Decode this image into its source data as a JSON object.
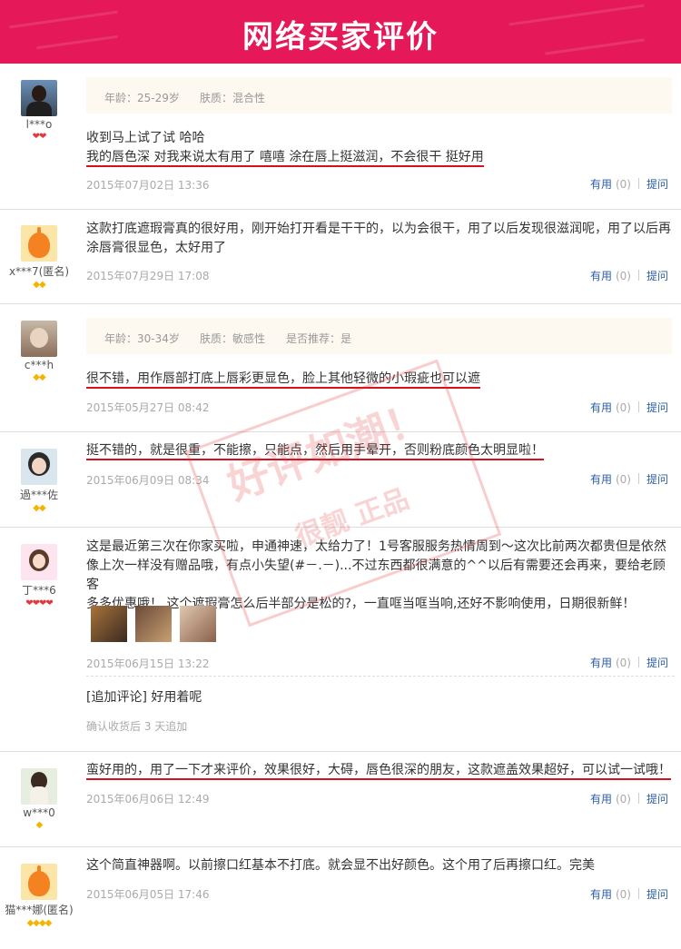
{
  "page": {
    "title": "网络买家评价"
  },
  "watermark": {
    "line1": "好评如潮！",
    "line2": "很靓 正品"
  },
  "labels": {
    "useful": "有用",
    "ask": "提问"
  },
  "reviews": [
    {
      "user": "l***o",
      "rank": "❤❤",
      "rank_color": "red",
      "info": [
        "年龄：25-29岁",
        "肤质：混合性"
      ],
      "lines": [
        "收到马上试了试 哈哈",
        "我的唇色深 对我来说太有用了 嘻嘻 涂在唇上挺滋润，不会很干 挺好用"
      ],
      "date": "2015年07月02日 13:36",
      "useful_count": "(0)"
    },
    {
      "user": "x***7(匿名)",
      "rank": "◆◆",
      "rank_color": "gold",
      "lines": [
        "这款打底遮瑕膏真的很好用，刚开始打开看是干干的，以为会很干，用了以后发现很滋润呢，用了以后再",
        "涂唇膏很显色，太好用了"
      ],
      "date": "2015年07月29日 17:08",
      "useful_count": "(0)"
    },
    {
      "user": "c***h",
      "rank": "◆◆",
      "rank_color": "gold",
      "info": [
        "年龄：30-34岁",
        "肤质：敏感性",
        "是否推荐：是"
      ],
      "lines": [
        "很不错，用作唇部打底上唇彩更显色，脸上其他轻微的小瑕疵也可以遮"
      ],
      "date": "2015年05月27日 08:42",
      "useful_count": "(0)"
    },
    {
      "user": "過***佐",
      "rank": "◆◆",
      "rank_color": "gold",
      "lines": [
        "挺不错的，就是很重，不能擦，只能点，然后用手晕开，否则粉底颜色太明显啦！"
      ],
      "date": "2015年06月09日 08:34",
      "useful_count": "(0)"
    },
    {
      "user": "丁***6",
      "rank": "❤❤❤❤",
      "rank_color": "red",
      "lines": [
        "这是最近第三次在你家买啦，申通神速，太给力了！1号客服服务热情周到～这次比前两次都贵但是依然",
        "像上次一样没有赠品哦，有点小失望(#－.－)...不过东西都很满意的^^以后有需要还会再来，要给老顾客",
        "多多优惠哦！ 这个遮瑕膏怎么后半部分是松的?，一直哐当哐当响,还好不影响使用，日期很新鲜！"
      ],
      "date": "2015年06月15日 13:22",
      "useful_count": "(0)",
      "followup": "[追加评论] 好用着呢",
      "followup_note": "确认收货后 3 天追加"
    },
    {
      "user": "w***0",
      "rank": "◆",
      "rank_color": "gold",
      "lines": [
        "蛮好用的，用了一下才来评价，效果很好，大碍，唇色很深的朋友，这款遮盖效果超好，可以试一试哦！"
      ],
      "date": "2015年06月06日 12:49",
      "useful_count": "(0)"
    },
    {
      "user": "猫***娜(匿名)",
      "rank": "◆◆◆◆",
      "rank_color": "gold",
      "lines": [
        "这个简直神器啊。以前擦口红基本不打底。就会显不出好颜色。这个用了后再擦口红。完美"
      ],
      "date": "2015年06月05日 17:46",
      "useful_count": "(0)"
    }
  ]
}
